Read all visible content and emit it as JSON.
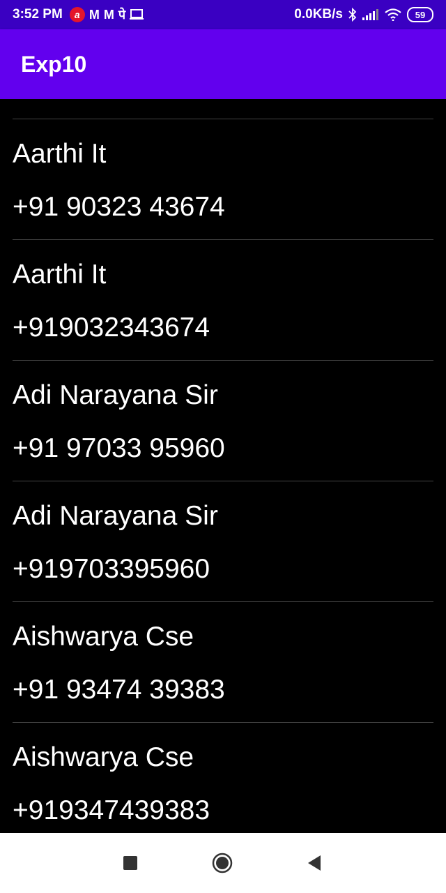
{
  "status_bar": {
    "time": "3:52 PM",
    "net_speed": "0.0KB/s",
    "battery": "59",
    "notif_glyphs": [
      "M",
      "M",
      "पे"
    ]
  },
  "app_bar": {
    "title": "Exp10"
  },
  "contacts": [
    {
      "name": "Aarthi It",
      "phone": "+91 90323 43674"
    },
    {
      "name": "Aarthi It",
      "phone": "+919032343674"
    },
    {
      "name": "Adi Narayana Sir",
      "phone": "+91 97033 95960"
    },
    {
      "name": "Adi Narayana Sir",
      "phone": "+919703395960"
    },
    {
      "name": "Aishwarya Cse",
      "phone": "+91 93474 39383"
    },
    {
      "name": "Aishwarya Cse",
      "phone": "+919347439383"
    }
  ],
  "colors": {
    "status_bar": "#3a00c2",
    "app_bar": "#6200ee",
    "background": "#000000",
    "text": "#ffffff"
  }
}
